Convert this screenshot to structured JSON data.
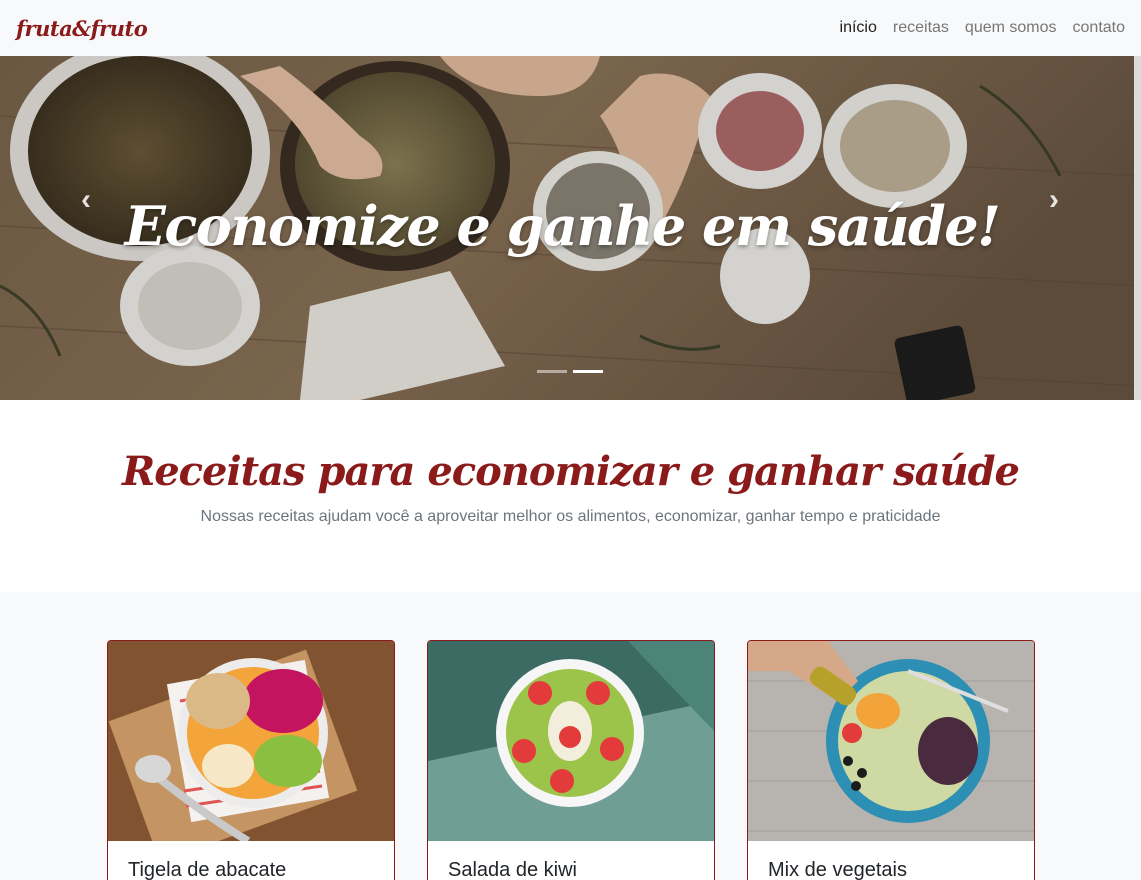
{
  "navbar": {
    "brand": "fruta&fruto",
    "links": [
      {
        "label": "início",
        "active": true
      },
      {
        "label": "receitas",
        "active": false
      },
      {
        "label": "quem somos",
        "active": false
      },
      {
        "label": "contato",
        "active": false
      }
    ]
  },
  "carousel": {
    "caption": "Economize e ganhe em saúde!",
    "prev_icon": "chevron-left-icon",
    "next_icon": "chevron-right-icon",
    "prev_glyph": "‹",
    "next_glyph": "›",
    "slides_count": 2,
    "active_slide": 2
  },
  "intro": {
    "title": "Receitas para economizar e ganhar saúde",
    "subtitle": "Nossas receitas ajudam você a aproveitar melhor os alimentos, economizar, ganhar tempo e praticidade"
  },
  "cards": [
    {
      "title": "Tigela de abacate"
    },
    {
      "title": "Salada de kiwi"
    },
    {
      "title": "Mix de vegetais"
    }
  ],
  "colors": {
    "brand": "#8b1a1a",
    "navbar_bg": "#f8f9fa",
    "muted_text": "#6c757d"
  }
}
